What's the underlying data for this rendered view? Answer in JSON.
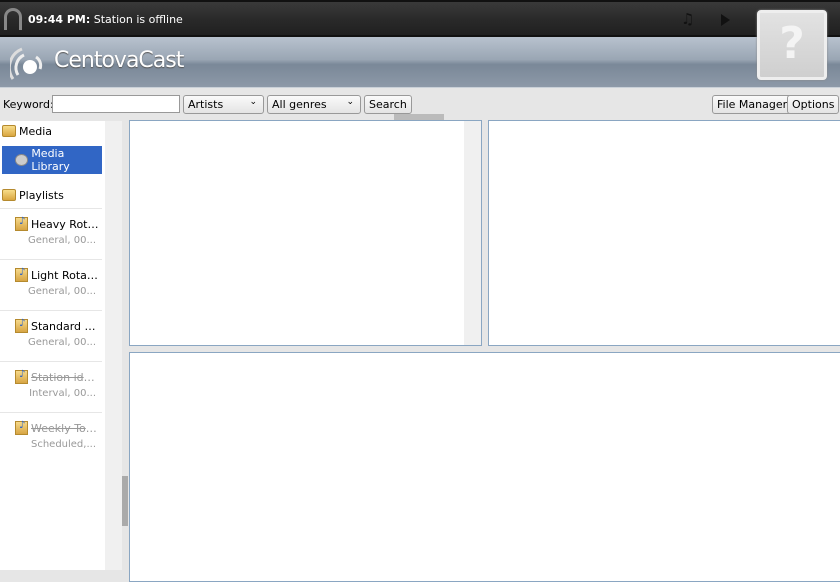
{
  "status": {
    "time": "09:44 PM:",
    "message": "Station is offline"
  },
  "icons": {
    "status": "headphones-icon",
    "music": "music-note-icon",
    "play": "play-icon",
    "album": "question-mark-icon"
  },
  "header": {
    "logo": "CentovaCast",
    "album_placeholder": "?"
  },
  "toolbar": {
    "keyword_label": "Keyword:",
    "keyword_value": "",
    "type_select": "Artists",
    "genre_select": "All genres",
    "search": "Search",
    "file_manager": "File Manager",
    "options": "Options"
  },
  "sidebar": {
    "media_label": "Media",
    "media_library": "Media Library",
    "playlists_label": "Playlists",
    "playlists": [
      {
        "title": "Heavy Rotat...",
        "sub": "General, 00...",
        "disabled": false
      },
      {
        "title": "Light Rotation",
        "sub": "General, 00...",
        "disabled": false
      },
      {
        "title": "Standard Ro...",
        "sub": "General, 00...",
        "disabled": false
      },
      {
        "title": "Station ident...",
        "sub": "Interval, 00...",
        "disabled": true
      },
      {
        "title": "Weekly Top ...",
        "sub": "Scheduled,...",
        "disabled": true
      }
    ]
  },
  "colors": {
    "accent": "#3166c5",
    "pane_border": "#8aa6c2"
  }
}
